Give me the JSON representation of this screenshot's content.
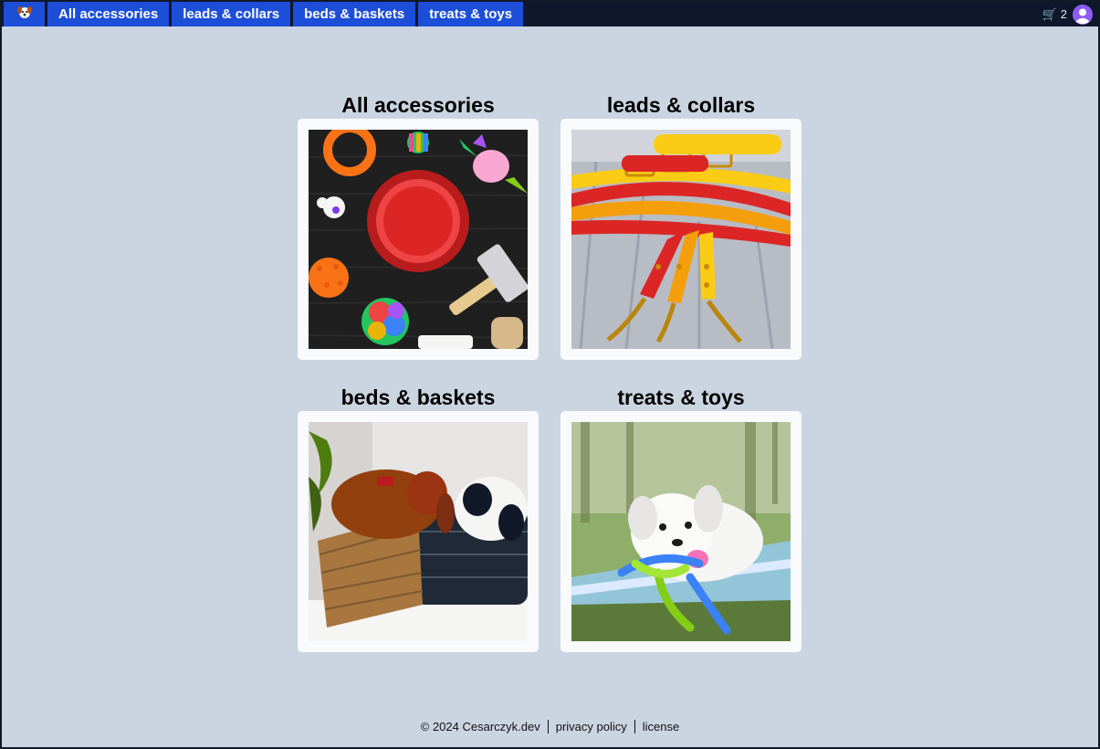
{
  "nav": {
    "logo_icon": "dog-face-icon",
    "tabs": [
      {
        "label": "All accessories"
      },
      {
        "label": "leads & collars"
      },
      {
        "label": "beds & baskets"
      },
      {
        "label": "treats & toys"
      }
    ],
    "cart_icon": "shopping-cart-icon",
    "cart_count": "2",
    "avatar_icon": "user-avatar-icon"
  },
  "categories": [
    {
      "title": "All accessories",
      "image": "accessories-photo"
    },
    {
      "title": "leads & collars",
      "image": "leads-collars-photo"
    },
    {
      "title": "beds & baskets",
      "image": "beds-baskets-photo"
    },
    {
      "title": "treats & toys",
      "image": "treats-toys-photo"
    }
  ],
  "footer": {
    "copyright": "© 2024 Cesarczyk.dev",
    "privacy": "privacy policy",
    "license": "license"
  },
  "colors": {
    "nav_bg": "#0f172a",
    "tab_bg": "#1d4ed8",
    "page_bg": "#cbd5e1",
    "card_bg": "#f8fafc"
  }
}
